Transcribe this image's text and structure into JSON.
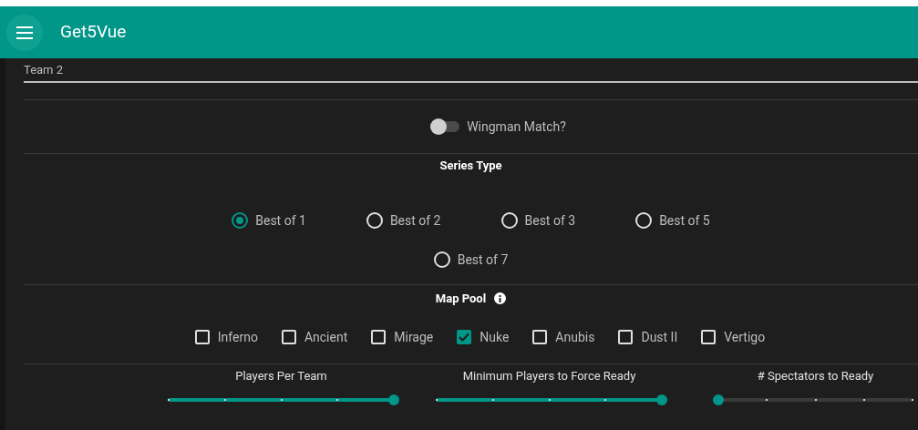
{
  "app_bar": {
    "title": "Get5Vue"
  },
  "team_field": {
    "label": "Team 2"
  },
  "wingman": {
    "label": "Wingman Match?",
    "on": false
  },
  "series_type": {
    "title": "Series Type",
    "options": [
      {
        "label": "Best of 1",
        "selected": true
      },
      {
        "label": "Best of 2",
        "selected": false
      },
      {
        "label": "Best of 3",
        "selected": false
      },
      {
        "label": "Best of 5",
        "selected": false
      },
      {
        "label": "Best of 7",
        "selected": false
      }
    ]
  },
  "map_pool": {
    "title": "Map Pool",
    "maps": [
      {
        "label": "Inferno",
        "checked": false
      },
      {
        "label": "Ancient",
        "checked": false
      },
      {
        "label": "Mirage",
        "checked": false
      },
      {
        "label": "Nuke",
        "checked": true
      },
      {
        "label": "Anubis",
        "checked": false
      },
      {
        "label": "Dust II",
        "checked": false
      },
      {
        "label": "Vertigo",
        "checked": false
      }
    ]
  },
  "sliders": [
    {
      "label": "Players Per Team",
      "level": 1
    },
    {
      "label": "Minimum Players to Force Ready",
      "level": 1
    },
    {
      "label": "# Spectators to Ready",
      "level": 0
    }
  ]
}
